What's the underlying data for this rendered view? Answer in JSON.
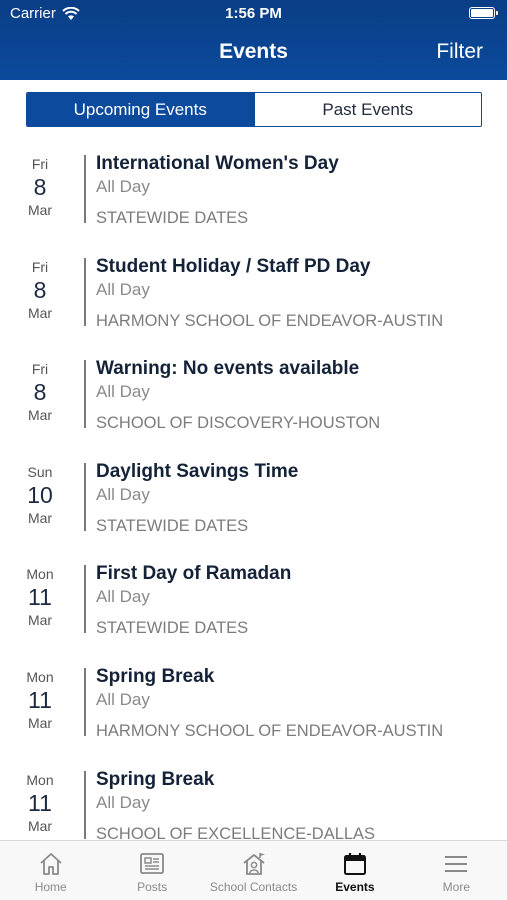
{
  "status": {
    "carrier": "Carrier",
    "time": "1:56 PM"
  },
  "nav": {
    "title": "Events",
    "filter_label": "Filter"
  },
  "segments": {
    "upcoming": "Upcoming Events",
    "past": "Past Events"
  },
  "events": [
    {
      "dow": "Fri",
      "day": "8",
      "month": "Mar",
      "title": "International Women's Day",
      "time": "All Day",
      "org": "STATEWIDE DATES"
    },
    {
      "dow": "Fri",
      "day": "8",
      "month": "Mar",
      "title": "Student Holiday / Staff PD Day",
      "time": "All Day",
      "org": "HARMONY SCHOOL OF ENDEAVOR-AUSTIN"
    },
    {
      "dow": "Fri",
      "day": "8",
      "month": "Mar",
      "title": "Warning: No events available",
      "time": "All Day",
      "org": "SCHOOL OF DISCOVERY-HOUSTON"
    },
    {
      "dow": "Sun",
      "day": "10",
      "month": "Mar",
      "title": "Daylight Savings Time",
      "time": "All Day",
      "org": "STATEWIDE DATES"
    },
    {
      "dow": "Mon",
      "day": "11",
      "month": "Mar",
      "title": "First Day of Ramadan",
      "time": "All Day",
      "org": "STATEWIDE DATES"
    },
    {
      "dow": "Mon",
      "day": "11",
      "month": "Mar",
      "title": "Spring Break",
      "time": "All Day",
      "org": "HARMONY SCHOOL OF ENDEAVOR-AUSTIN"
    },
    {
      "dow": "Mon",
      "day": "11",
      "month": "Mar",
      "title": "Spring Break",
      "time": "All Day",
      "org": "SCHOOL OF EXCELLENCE-DALLAS"
    }
  ],
  "tabs": {
    "home": "Home",
    "posts": "Posts",
    "contacts": "School Contacts",
    "events": "Events",
    "more": "More"
  },
  "colors": {
    "brand": "#0b4a9c",
    "title_text": "#142238",
    "muted": "#8a8a8a"
  }
}
